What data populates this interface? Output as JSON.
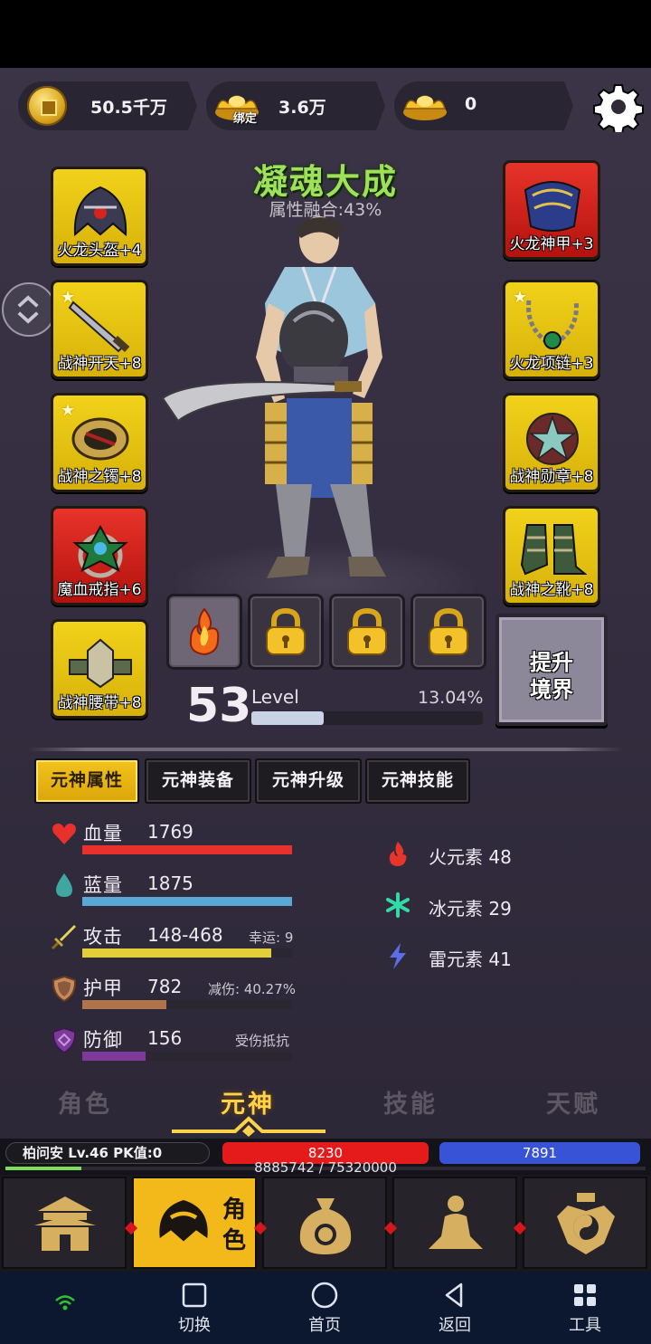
{
  "currencies": [
    {
      "name": "coin-icon",
      "value": "50.5千万"
    },
    {
      "name": "bound-ingot-icon",
      "value": "3.6万",
      "tag": "绑定"
    },
    {
      "name": "ingot-icon",
      "value": "0"
    }
  ],
  "realm": {
    "title": "凝魂大成",
    "fusion": "属性融合:43%"
  },
  "equipment_left": [
    {
      "label": "火龙头盔+4",
      "rarity": "gold",
      "star": false
    },
    {
      "label": "战神开天+8",
      "rarity": "gold",
      "star": true
    },
    {
      "label": "战神之镯+8",
      "rarity": "gold",
      "star": true
    },
    {
      "label": "魔血戒指+6",
      "rarity": "red",
      "star": false
    },
    {
      "label": "战神腰带+8",
      "rarity": "gold",
      "star": false
    }
  ],
  "equipment_right": [
    {
      "label": "火龙神甲+3",
      "rarity": "red",
      "star": false
    },
    {
      "label": "火龙项链+3",
      "rarity": "gold",
      "star": true
    },
    {
      "label": "战神勋章+8",
      "rarity": "gold",
      "star": false
    },
    {
      "label": "战神之靴+8",
      "rarity": "gold",
      "star": false
    }
  ],
  "soul_slots": [
    "flame-soul-icon",
    "lock-icon",
    "lock-icon",
    "lock-icon"
  ],
  "upgrade_button": {
    "line1": "提升",
    "line2": "境界"
  },
  "level": {
    "number": "53",
    "label": "Level",
    "percent_text": "13.04%",
    "progress": 0.1304
  },
  "subtabs": [
    "元神属性",
    "元神装备",
    "元神升级",
    "元神技能"
  ],
  "active_subtab": 0,
  "stats": [
    {
      "icon": "heart-icon",
      "name": "血量",
      "value": "1769",
      "note": "",
      "fill": 1.0,
      "color": "#e8302c"
    },
    {
      "icon": "drop-icon",
      "name": "蓝量",
      "value": "1875",
      "note": "",
      "fill": 1.0,
      "color": "#5aa8d6"
    },
    {
      "icon": "sword-icon",
      "name": "攻击",
      "value": "148-468",
      "note": "幸运: 9",
      "fill": 0.9,
      "color": "#e3cf3a"
    },
    {
      "icon": "shield-icon",
      "name": "护甲",
      "value": "782",
      "note": "减伤: 40.27%",
      "fill": 0.4,
      "color": "#b0734a"
    },
    {
      "icon": "defense-icon",
      "name": "防御",
      "value": "156",
      "note": "受伤抵抗",
      "fill": 0.3,
      "color": "#7d3a9b"
    }
  ],
  "elements": [
    {
      "icon": "fire-icon",
      "text": "火元素 48",
      "color": "#e8352a"
    },
    {
      "icon": "ice-icon",
      "text": "冰元素 29",
      "color": "#33d9a8"
    },
    {
      "icon": "lightning-icon",
      "text": "雷元素 41",
      "color": "#5a6ee8"
    }
  ],
  "main_tabs": [
    "角色",
    "元神",
    "技能",
    "天赋"
  ],
  "active_main_tab": 1,
  "player": {
    "info": "柏问安  Lv.46 PK值:0",
    "hp": "8230",
    "mp": "7891",
    "exp_text": "8885742 / 75320000",
    "exp_progress": 0.118
  },
  "game_nav": [
    {
      "icon": "palace-icon",
      "label": ""
    },
    {
      "icon": "helmet-icon",
      "label": "角色"
    },
    {
      "icon": "money-bag-icon",
      "label": ""
    },
    {
      "icon": "meditate-icon",
      "label": ""
    },
    {
      "icon": "taiji-icon",
      "label": ""
    }
  ],
  "android_nav": [
    {
      "icon": "square-icon",
      "label": "切换"
    },
    {
      "icon": "circle-icon",
      "label": "首页"
    },
    {
      "icon": "back-icon",
      "label": "返回"
    },
    {
      "icon": "grid-icon",
      "label": "工具"
    }
  ]
}
